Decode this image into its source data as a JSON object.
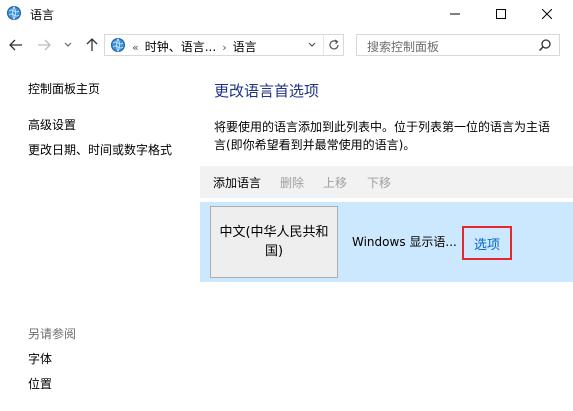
{
  "window": {
    "title": "语言",
    "icon": "globe-control-panel-icon"
  },
  "address": {
    "overflow": "«",
    "crumbs": [
      "时钟、语言...",
      "语言"
    ],
    "separator": "›"
  },
  "search": {
    "placeholder": "搜索控制面板"
  },
  "sidebar": {
    "home": "控制面板主页",
    "links": [
      "高级设置",
      "更改日期、时间或数字格式"
    ],
    "see_also_header": "另请参阅",
    "see_also": [
      "字体",
      "位置"
    ]
  },
  "main": {
    "title": "更改语言首选项",
    "description": "将要使用的语言添加到此列表中。位于列表第一位的语言为主语言(即你希望看到并最常使用的语言)。"
  },
  "toolbar": {
    "add": "添加语言",
    "remove": "删除",
    "move_up": "上移",
    "move_down": "下移"
  },
  "languages": [
    {
      "name": "中文(中华人民共和国)",
      "display_status": "Windows 显示语...",
      "options_label": "选项"
    }
  ],
  "colors": {
    "title_blue": "#1e3287",
    "selected_row": "#cce8ff",
    "link_blue": "#0066cc",
    "highlight_red": "#e4282d"
  }
}
